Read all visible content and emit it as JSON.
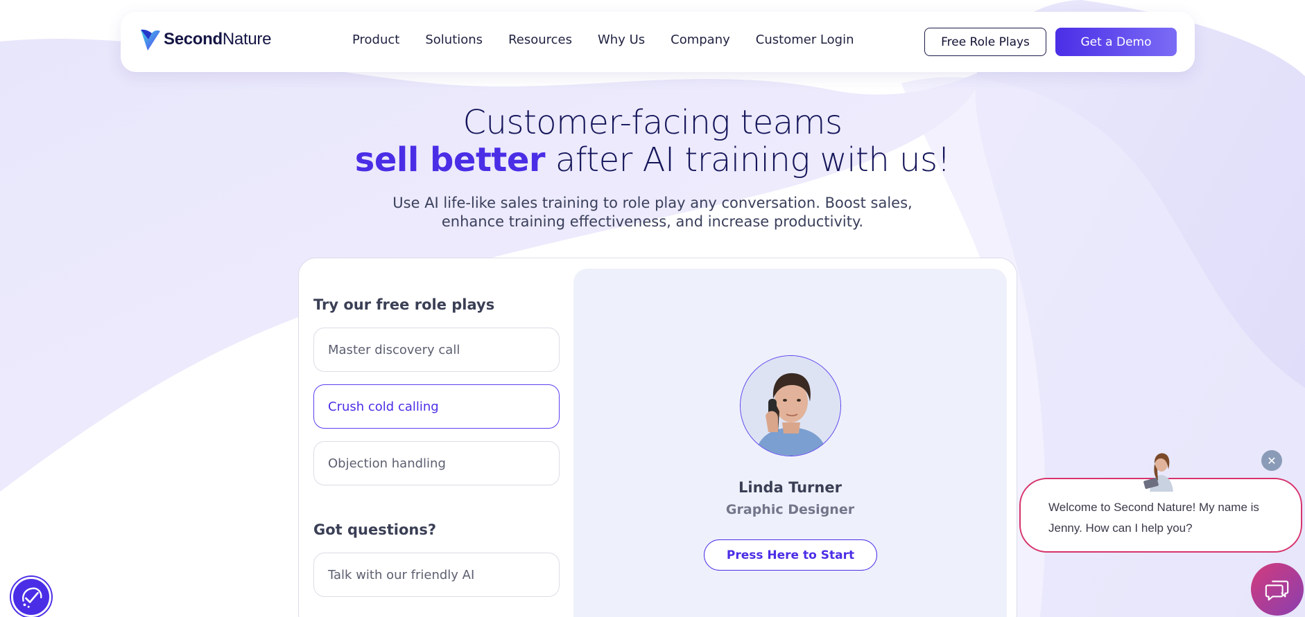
{
  "brand": {
    "name_bold": "Second",
    "name_regular": "Nature",
    "accent": "#4a2ee6"
  },
  "nav": {
    "items": [
      {
        "label": "Product"
      },
      {
        "label": "Solutions"
      },
      {
        "label": "Resources"
      },
      {
        "label": "Why Us"
      },
      {
        "label": "Company"
      },
      {
        "label": "Customer Login"
      }
    ],
    "free_role_plays": "Free Role Plays",
    "get_demo": "Get a Demo"
  },
  "hero": {
    "line1": "Customer-facing teams",
    "line2_accent": "sell better",
    "line2_rest": " after AI training with us!",
    "sub_line1": "Use AI life-like sales training to role play any conversation. Boost sales,",
    "sub_line2": "enhance training effectiveness, and increase productivity."
  },
  "card": {
    "roleplays_title": "Try our free role plays",
    "options": [
      {
        "label": "Master discovery call"
      },
      {
        "label": "Crush cold calling"
      },
      {
        "label": "Objection handling"
      }
    ],
    "active_option": "Crush cold calling",
    "questions_title": "Got questions?",
    "questions_option": "Talk with our friendly AI",
    "persona": {
      "name": "Linda Turner",
      "role": "Graphic Designer",
      "start": "Press Here to Start"
    }
  },
  "chat": {
    "message": "Welcome to Second Nature! My name is Jenny. How can I help you?",
    "close_glyph": "✕",
    "border_color": "#d6336c"
  },
  "icons": {
    "logo": "second-nature-logo-icon",
    "chat_launcher": "chat-bubbles-icon",
    "accessibility": "accessibility-check-icon",
    "close": "close-icon"
  }
}
